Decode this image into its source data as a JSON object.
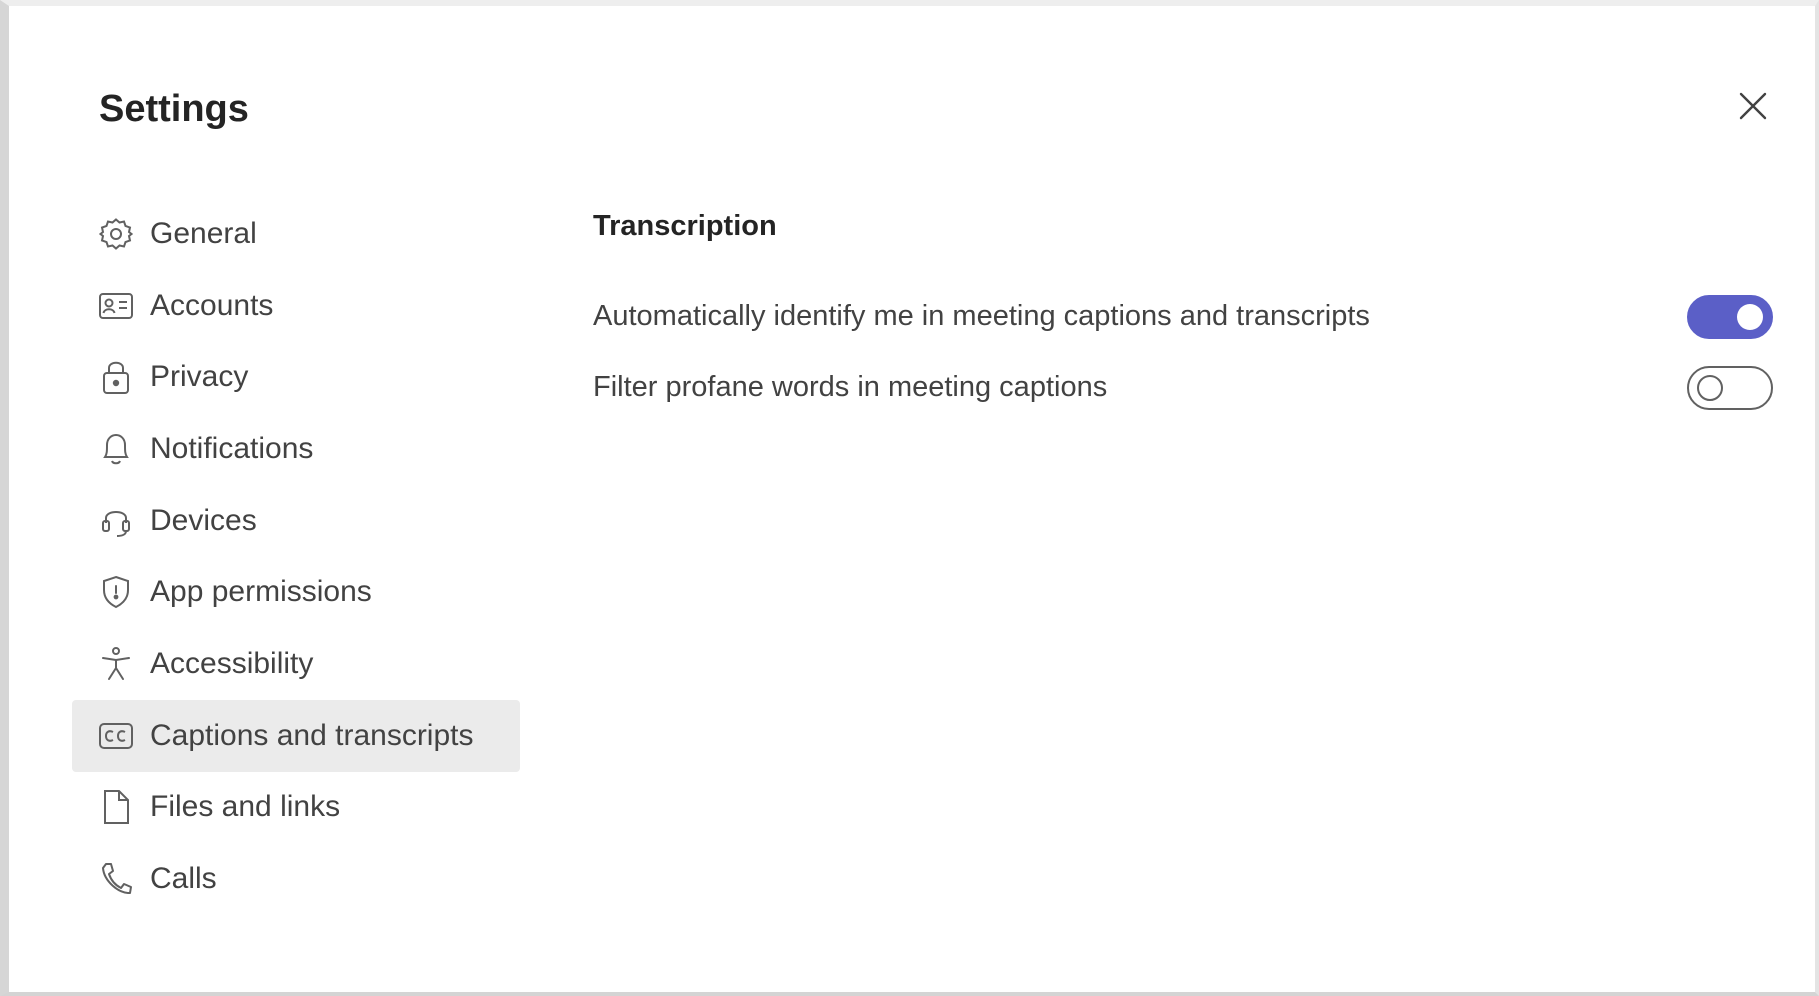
{
  "dialog": {
    "title": "Settings",
    "close_icon": "close-icon"
  },
  "sidebar": {
    "items": [
      {
        "label": "General",
        "icon": "gear-icon",
        "active": false
      },
      {
        "label": "Accounts",
        "icon": "id-card-icon",
        "active": false
      },
      {
        "label": "Privacy",
        "icon": "lock-icon",
        "active": false
      },
      {
        "label": "Notifications",
        "icon": "bell-icon",
        "active": false
      },
      {
        "label": "Devices",
        "icon": "headset-icon",
        "active": false
      },
      {
        "label": "App permissions",
        "icon": "shield-icon",
        "active": false
      },
      {
        "label": "Accessibility",
        "icon": "accessibility-icon",
        "active": false
      },
      {
        "label": "Captions and transcripts",
        "icon": "closed-captions-icon",
        "active": true
      },
      {
        "label": "Files and links",
        "icon": "document-icon",
        "active": false
      },
      {
        "label": "Calls",
        "icon": "phone-icon",
        "active": false
      }
    ]
  },
  "main": {
    "section_title": "Transcription",
    "settings": [
      {
        "label": "Automatically identify me in meeting captions and transcripts",
        "enabled": true
      },
      {
        "label": "Filter profane words in meeting captions",
        "enabled": false
      }
    ]
  },
  "colors": {
    "accent": "#5b5fc7",
    "active_nav_bg": "#ebebeb",
    "text": "#242424"
  }
}
